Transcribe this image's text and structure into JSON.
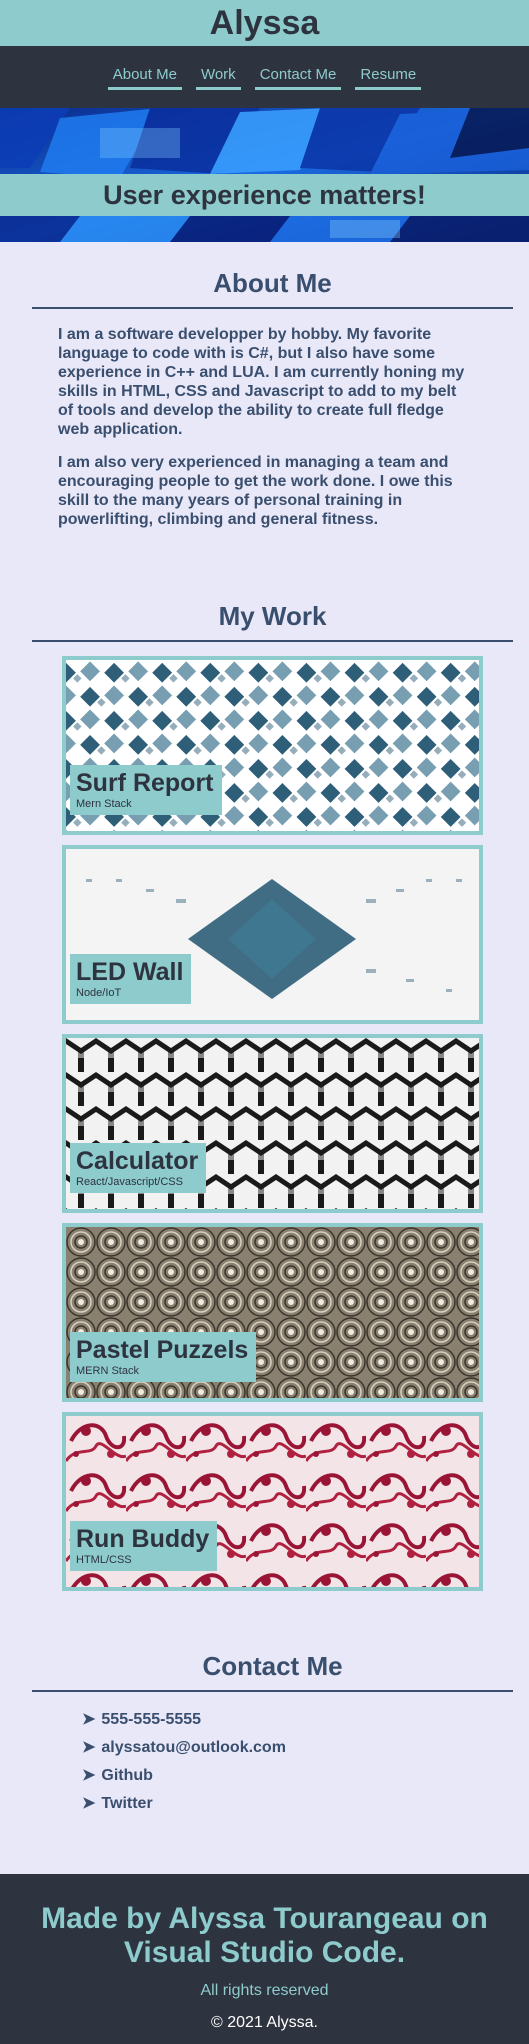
{
  "header": {
    "title": "Alyssa"
  },
  "nav": {
    "items": [
      {
        "label": "About Me"
      },
      {
        "label": "Work"
      },
      {
        "label": "Contact Me"
      },
      {
        "label": "Resume"
      }
    ]
  },
  "hero": {
    "tagline": "User experience matters!"
  },
  "about": {
    "heading": "About Me",
    "paragraphs": [
      "I am a software developper by hobby. My favorite language to code with is C#, but I also have some experience in C++ and LUA. I am currently honing my skills in HTML, CSS and Javascript to add to my belt of tools and develop the ability to create full fledge web application.",
      "I am also very experienced in managing a team and encouraging people to get the work done. I owe this skill to the many years of personal training in powerlifting, climbing and general fitness."
    ]
  },
  "work": {
    "heading": "My Work",
    "projects": [
      {
        "name": "Surf Report",
        "tech": "Mern Stack",
        "pattern": "diamond-mosaic"
      },
      {
        "name": "LED Wall",
        "tech": "Node/IoT",
        "pattern": "halftone-diamonds"
      },
      {
        "name": "Calculator",
        "tech": "React/Javascript/CSS",
        "pattern": "interlocking-y"
      },
      {
        "name": "Pastel Puzzels",
        "tech": "MERN Stack",
        "pattern": "concentric-circles"
      },
      {
        "name": "Run Buddy",
        "tech": "HTML/CSS",
        "pattern": "red-lace"
      }
    ]
  },
  "contact": {
    "heading": "Contact Me",
    "items": [
      {
        "icon": "arrow-icon",
        "text": "555-555-5555"
      },
      {
        "icon": "arrow-icon",
        "text": "alyssatou@outlook.com"
      },
      {
        "icon": "arrow-icon",
        "text": "Github"
      },
      {
        "icon": "arrow-icon",
        "text": "Twitter"
      }
    ]
  },
  "footer": {
    "title": "Made by Alyssa Tourangeau on Visual Studio Code.",
    "rights": "All rights reserved",
    "copyright": "© 2021 Alyssa."
  },
  "colors": {
    "accent": "#8ecbcc",
    "dark": "#2e3340",
    "text": "#3a4e6e",
    "background": "#e8e8f8"
  }
}
